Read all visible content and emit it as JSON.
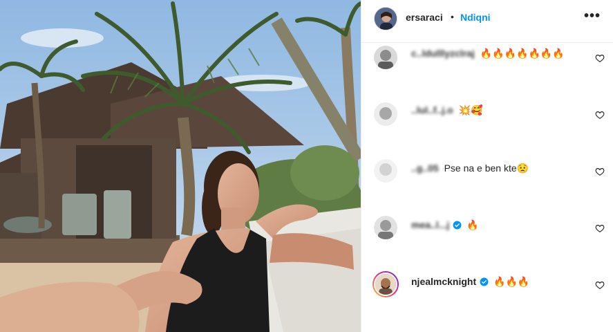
{
  "post": {
    "author": {
      "username": "ersaraci",
      "separator": "•",
      "follow_label": "Ndiqni",
      "more_label": "•••"
    }
  },
  "comments": [
    {
      "username": "c..ldulllyzclraj",
      "text": "🔥🔥🔥🔥🔥🔥🔥",
      "verified": false,
      "obscured": true
    },
    {
      "username": "..lul..f..j.o",
      "text": "💥🥰",
      "verified": false,
      "obscured": true
    },
    {
      "username": "..g..05",
      "text": "Pse na e ben kte😟",
      "verified": false,
      "obscured": true
    },
    {
      "username": "mea..l...j",
      "text": "🔥",
      "verified": true,
      "obscured": true
    },
    {
      "username": "njealmcknight",
      "text": "🔥🔥🔥",
      "verified": true,
      "obscured": false
    }
  ],
  "colors": {
    "accent": "#0095f6",
    "verified": "#0095f6",
    "text": "#262626",
    "divider": "#efefef"
  },
  "icons": [
    "more-options-icon",
    "verified-badge-icon",
    "heart-icon"
  ]
}
